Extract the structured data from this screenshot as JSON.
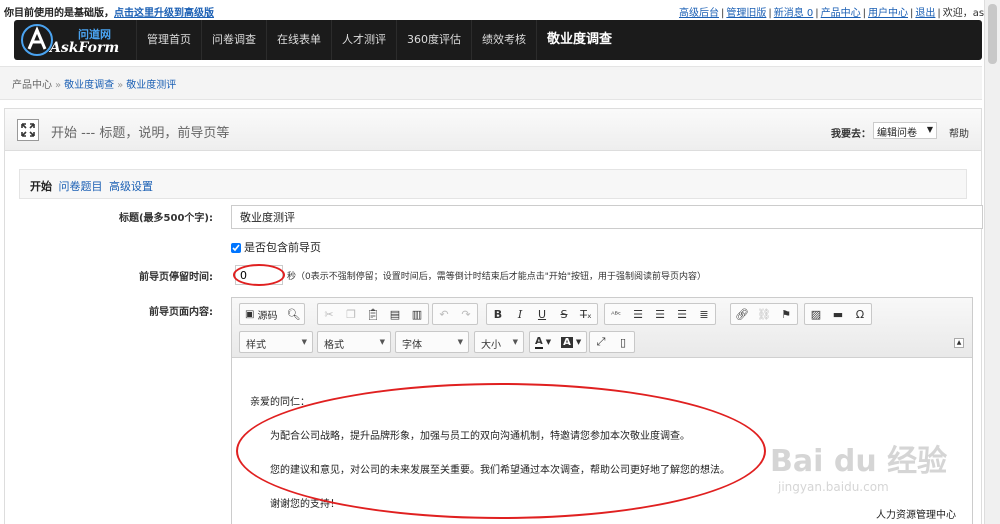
{
  "topbar": {
    "notice_prefix": "你目前使用的是基础版，",
    "notice_link": "点击这里升级到高级版",
    "links": [
      "高级后台",
      "管理旧版",
      "新消息 0",
      "产品中心",
      "用户中心",
      "退出"
    ],
    "welcome": "欢迎，asdf"
  },
  "logo": {
    "cn": "问道网",
    "en": "AskForm"
  },
  "nav": {
    "items": [
      "管理首页",
      "问卷调查",
      "在线表单",
      "人才测评",
      "360度评估",
      "绩效考核",
      "敬业度调查"
    ],
    "active_index": 6
  },
  "breadcrumb": {
    "items": [
      "产品中心",
      "敬业度调查",
      "敬业度测评"
    ]
  },
  "panel": {
    "title": "开始 --- 标题，说明，前导页等",
    "goto_label": "我要去：",
    "goto_value": "编辑问卷",
    "help": "帮助"
  },
  "subtabs": {
    "current": "开始",
    "links": [
      "问卷题目",
      "高级设置"
    ]
  },
  "form": {
    "title_label": "标题(最多500个字):",
    "title_value": "敬业度测评",
    "has_intro_label": "是否包含前导页",
    "has_intro_checked": true,
    "stay_label": "前导页停留时间:",
    "stay_value": "0",
    "stay_hint": "秒（0表示不强制停留；设置时间后，需等倒计时结束后才能点击\"开始\"按钮，用于强制阅读前导页内容）",
    "content_label": "前导页面内容:"
  },
  "editor": {
    "source_label": "源码",
    "combos": [
      "样式",
      "格式",
      "字体",
      "大小"
    ],
    "content": {
      "greeting": "亲爱的同仁：",
      "para1": "为配合公司战略，提升品牌形象，加强与员工的双向沟通机制，特邀请您参加本次敬业度调查。",
      "para2": "您的建议和意见，对公司的未来发展至关重要。我们希望通过本次调查，帮助公司更好地了解您的想法。",
      "thanks": "谢谢您的支持！",
      "signature": "人力资源管理中心"
    }
  },
  "watermark": {
    "main": "Bai du 经验",
    "sub": "jingyan.baidu.com"
  },
  "colors": {
    "accent": "#1a5fb4",
    "navbar": "#1b1b1b",
    "highlight": "#e02020"
  }
}
